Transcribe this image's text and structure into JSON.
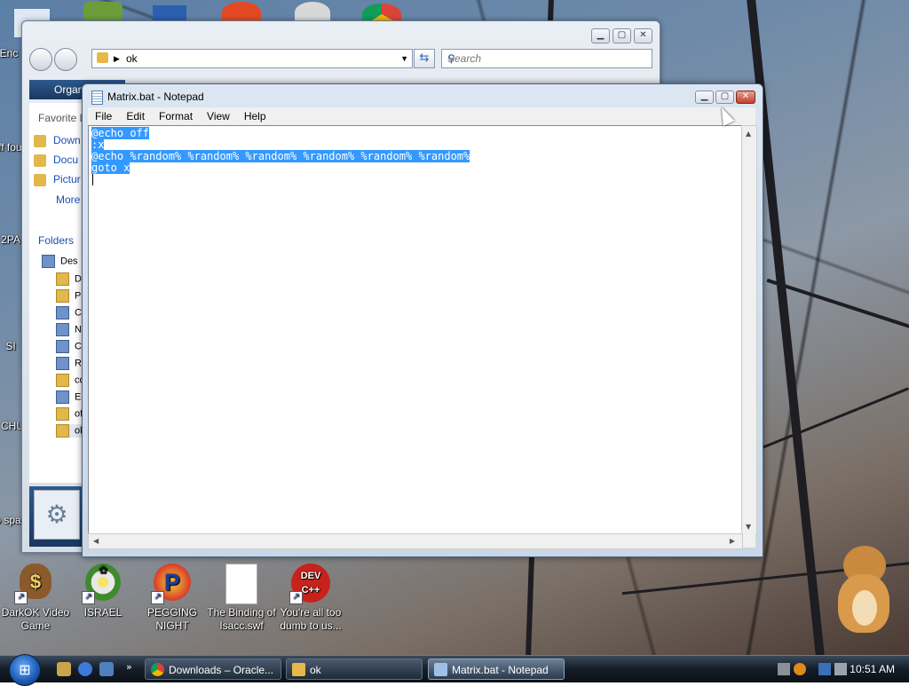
{
  "desktop": {
    "icons": [
      {
        "label": "DarkOK Video Game",
        "color": "#8a5a2b",
        "glyph": "$"
      },
      {
        "label": "ISRAEL",
        "color": "#d8d8d8",
        "glyph": "✿"
      },
      {
        "label": "PEGGING NIGHT",
        "color": "#d83a2a",
        "glyph": "P"
      },
      {
        "label": "The Binding of Isacc.swf",
        "color": "#ffffff",
        "glyph": ""
      },
      {
        "label": "You're all too dumb to us...",
        "color": "#c8221c",
        "glyph": "DEV C++"
      }
    ],
    "left_edge_labels": [
      "Enc",
      "off fou",
      "2PA",
      "SI",
      "CHU",
      "co spa"
    ]
  },
  "explorer": {
    "address_path": "ok",
    "search_placeholder": "Search",
    "organize_label": "Organ",
    "favorites_header": "Favorite L",
    "favorite_items": [
      "Down",
      "Docu",
      "Pictur"
    ],
    "more_label": "More",
    "folders_label": "Folders",
    "tree_items": [
      "Des",
      "D",
      "Pu",
      "C",
      "N",
      "C",
      "Re",
      "co",
      "En",
      "of",
      "ok"
    ]
  },
  "notepad": {
    "title": "Matrix.bat - Notepad",
    "menu": [
      "File",
      "Edit",
      "Format",
      "View",
      "Help"
    ],
    "lines": [
      "@echo off",
      ":x",
      "@echo %random% %random% %random% %random% %random% %random%",
      "goto x"
    ]
  },
  "taskbar": {
    "buttons": [
      {
        "label": "Downloads – Oracle...",
        "color": "#e04a2a"
      },
      {
        "label": "ok",
        "color": "#e6b84a"
      },
      {
        "label": "Matrix.bat - Notepad",
        "color": "#9fc0e6"
      }
    ],
    "clock": "10:51 AM"
  }
}
